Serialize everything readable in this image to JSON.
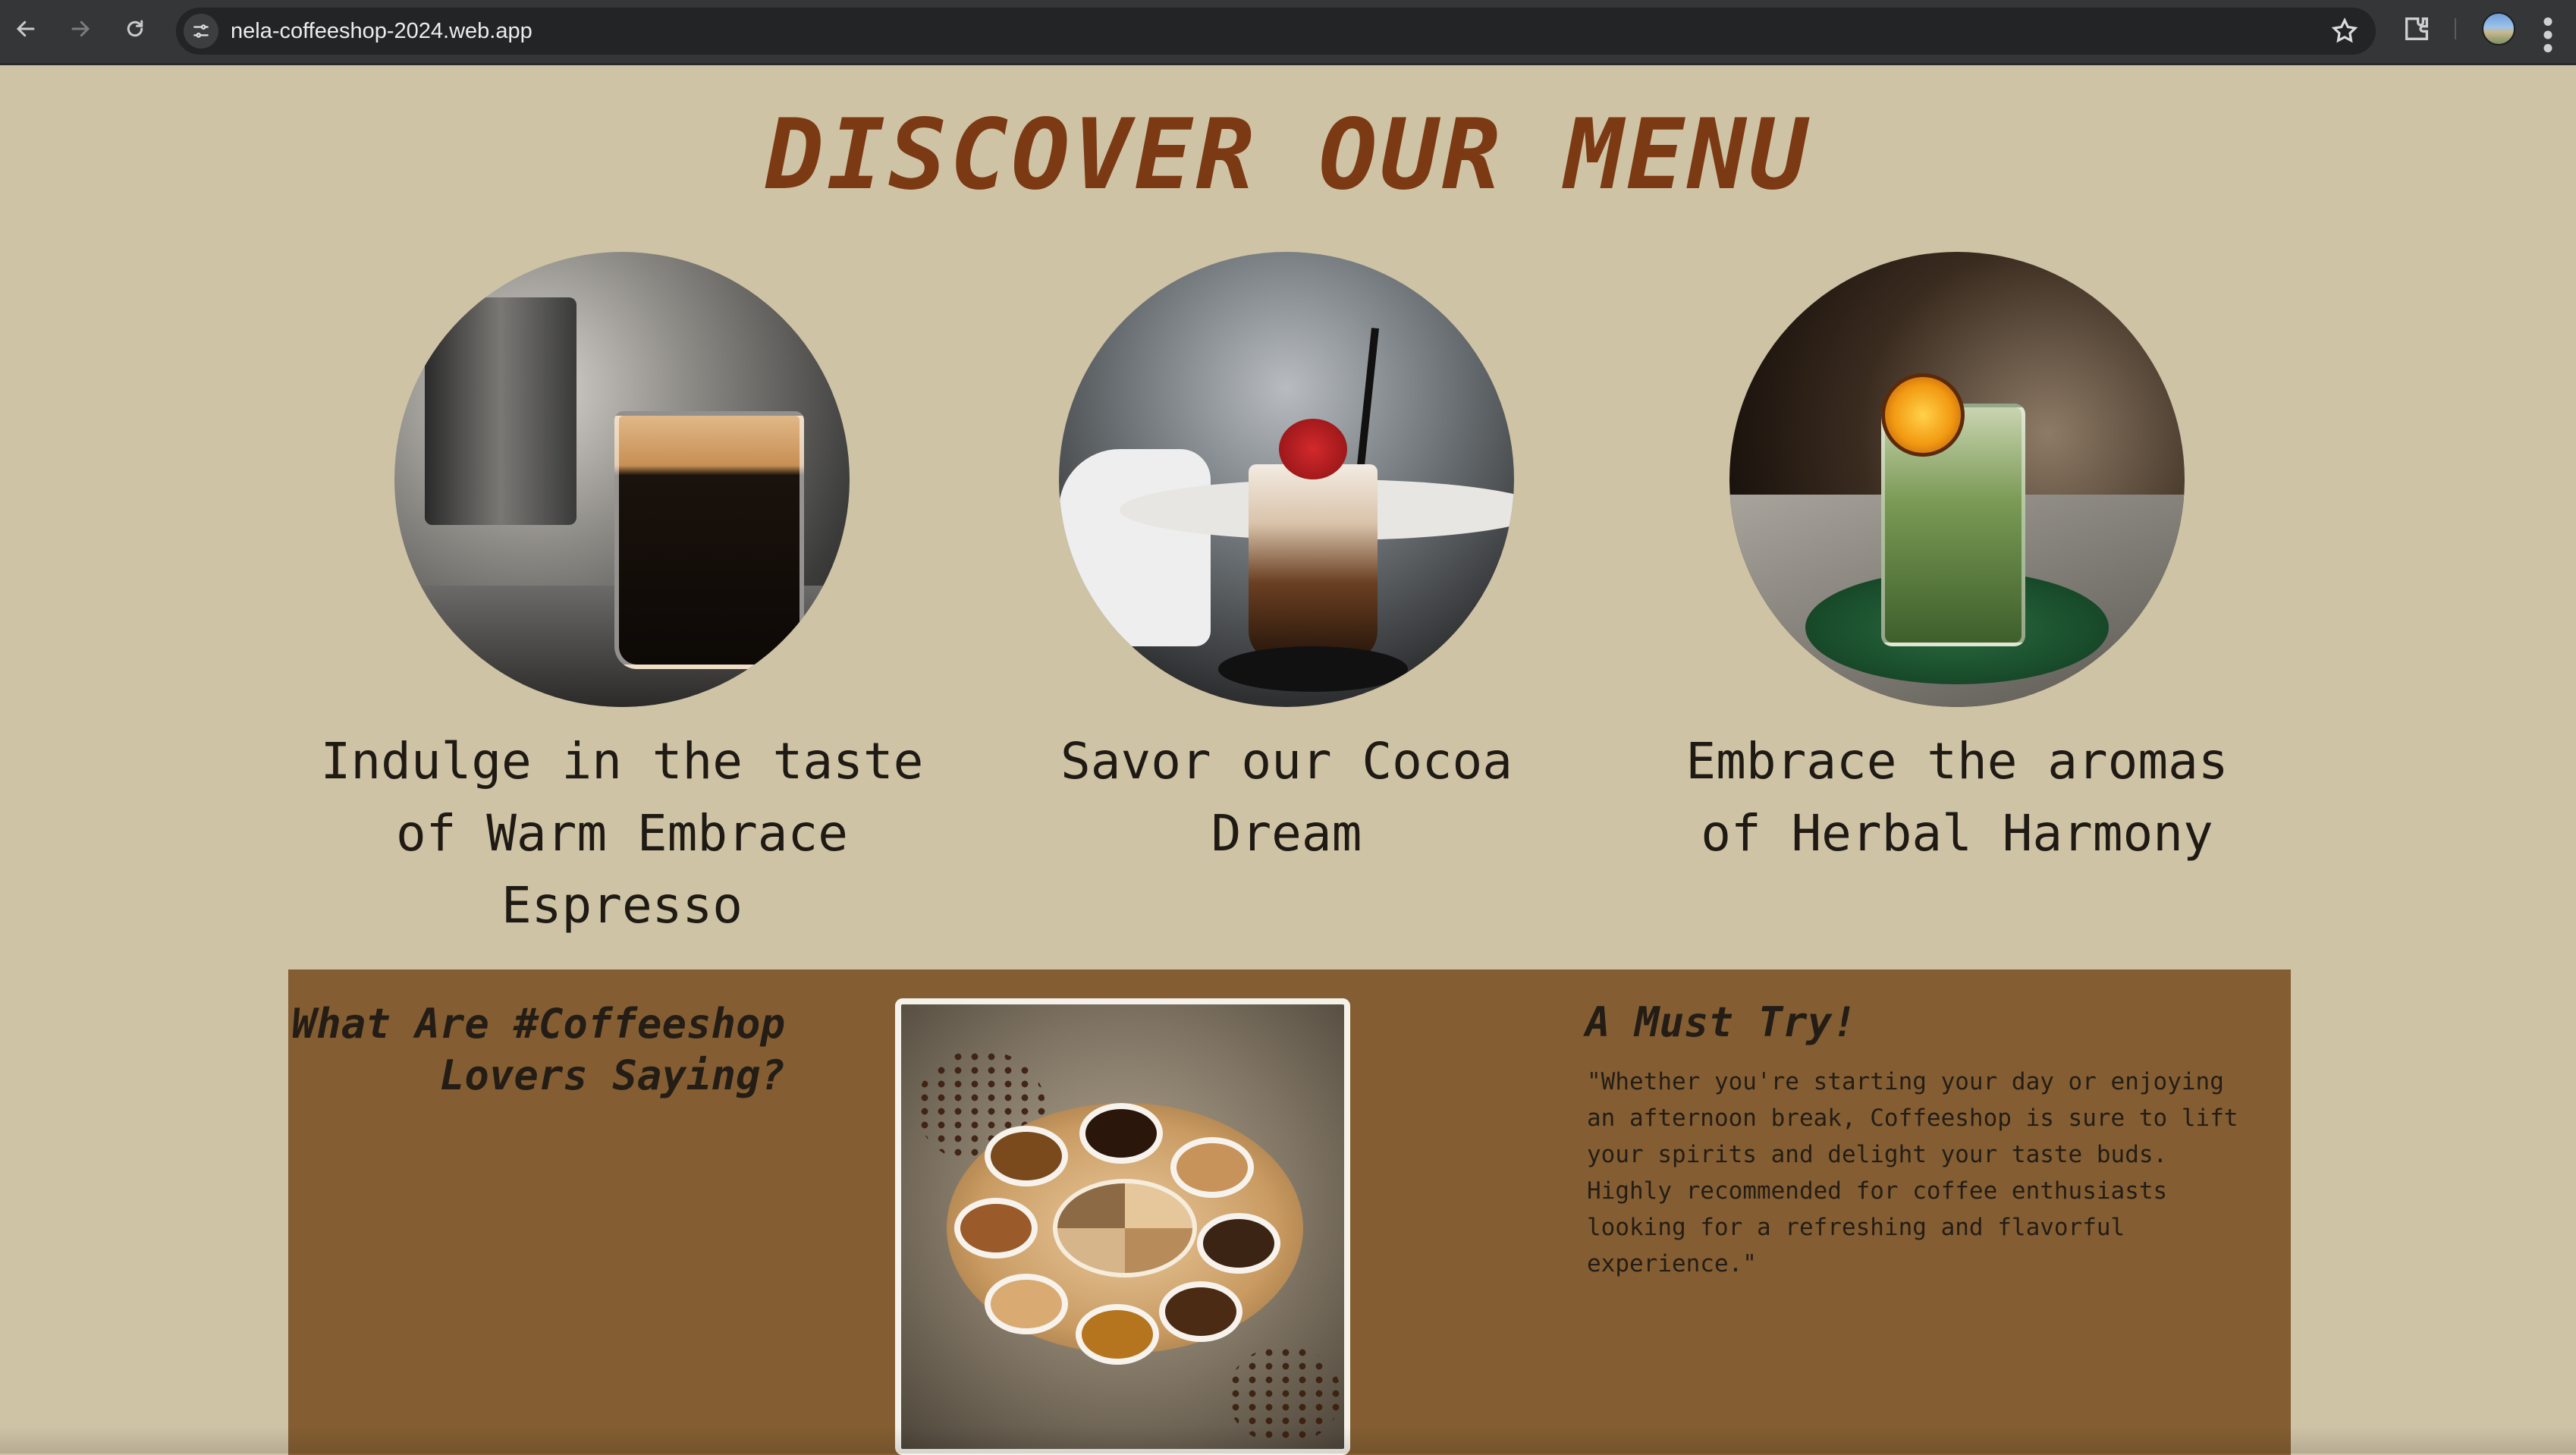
{
  "browser": {
    "url": "nela-coffeeshop-2024.web.app",
    "icons": [
      "back-arrow-icon",
      "forward-arrow-icon",
      "reload-icon",
      "site-info-icon",
      "bookmark-star-icon",
      "extensions-icon",
      "profile-avatar-icon",
      "more-menu-icon"
    ]
  },
  "page": {
    "title": "DISCOVER OUR MENU",
    "colors": {
      "background": "#cfc3a6",
      "title": "#7b3a13",
      "section_bg": "#845e32",
      "text_dark": "#241d16"
    }
  },
  "menu": [
    {
      "caption": "Indulge in the taste of Warm Embrace Espresso",
      "image": "espresso-glass-photo"
    },
    {
      "caption": "Savor our Cocoa Dream",
      "image": "cocoa-milkshake-photo"
    },
    {
      "caption": "Embrace the aromas of Herbal Harmony",
      "image": "herbal-drink-photo"
    }
  ],
  "testimonial": {
    "heading": "What Are #Coffeeshop Lovers Saying?",
    "feature_image": "coffee-platter-photo"
  },
  "must_try": {
    "title": "A Must Try!",
    "quote": "\"Whether you're starting your day or enjoying an afternoon break, Coffeeshop is sure to lift your spirits and delight your taste buds. Highly recommended for coffee enthusiasts looking for a refreshing and flavorful experience.\""
  }
}
